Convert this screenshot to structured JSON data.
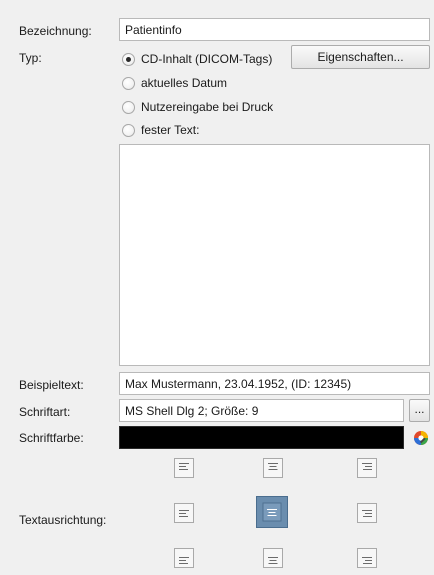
{
  "labels": {
    "bezeichnung": "Bezeichnung:",
    "typ": "Typ:",
    "beispieltext": "Beispieltext:",
    "schriftart": "Schriftart:",
    "schriftfarbe": "Schriftfarbe:",
    "textausrichtung": "Textausrichtung:"
  },
  "bezeichnung_value": "Patientinfo",
  "typ_options": [
    {
      "label": "CD-Inhalt (DICOM-Tags)",
      "checked": true
    },
    {
      "label": "aktuelles Datum",
      "checked": false
    },
    {
      "label": "Nutzereingabe bei Druck",
      "checked": false
    },
    {
      "label": "fester Text:",
      "checked": false
    }
  ],
  "eigenschaften_button": "Eigenschaften...",
  "fester_text_value": "",
  "beispieltext_value": "Max Mustermann, 23.04.1952, (ID: 12345)",
  "schriftart_value": "MS Shell Dlg 2; Größe: 9",
  "schriftart_browse_button": "...",
  "schriftfarbe_value": "#000000",
  "color_picker_icon": "color-wheel-icon",
  "textausrichtung": {
    "selected": "middle-center",
    "options": [
      "top-left",
      "top-center",
      "top-right",
      "middle-left",
      "middle-center",
      "middle-right",
      "bottom-left",
      "bottom-center",
      "bottom-right"
    ]
  }
}
